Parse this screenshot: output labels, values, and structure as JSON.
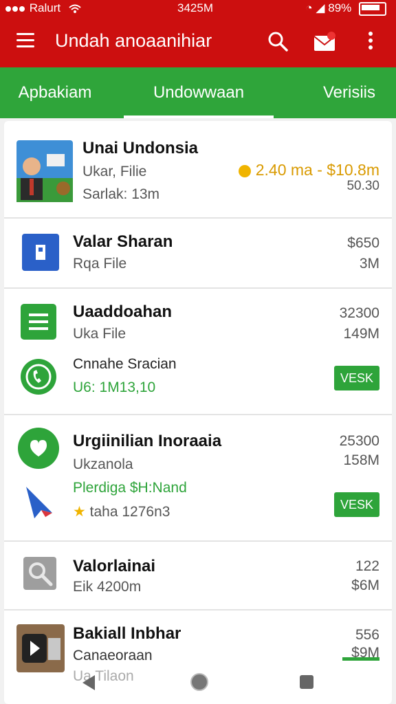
{
  "status": {
    "carrier": "Ralurt",
    "time": "3425M",
    "battery": "89%"
  },
  "appbar": {
    "title": "Undah anoaanihiar"
  },
  "tabs": [
    {
      "label": "Apbakiam"
    },
    {
      "label": "Undowwaan"
    },
    {
      "label": "Verisiis"
    }
  ],
  "items": [
    {
      "title": "Unai Undonsia",
      "sub1": "Ukar, Filie",
      "sub2": "Sarlak: 13m",
      "badge": "2.40 ma - $10.8m",
      "price2": "50.30"
    },
    {
      "title": "Valar Sharan",
      "sub1": "Rqa File",
      "price1": "$650",
      "price2": "3M"
    },
    {
      "title": "Uaaddoahan",
      "sub1": "Uka File",
      "price1": "32300",
      "price2": "149M"
    },
    {
      "title": "Cnnahe Sracian",
      "sub1": "U6: 1M13,10",
      "button": "VESK"
    },
    {
      "title": "Urgiinilian Inoraaia",
      "sub1": "Ukzanola",
      "sub2": "Plerdiga $H:Nand",
      "rating": "taha 1276n3",
      "price1": "25300",
      "price2": "158M",
      "button": "VESK"
    },
    {
      "title": "Valorlainai",
      "sub1": "Eik 4200m",
      "price1": "122",
      "price2": "$6M"
    },
    {
      "title": "Bakiall Inbhar",
      "sub1": "Canaeoraan",
      "sub2": "Ua Tilaon",
      "price1": "556",
      "price2": "$9M"
    }
  ],
  "colors": {
    "appbar": "#cc0f0f",
    "tabs": "#2fa53a",
    "accent_green": "#2ea43a",
    "price_orange": "#d99a00"
  }
}
